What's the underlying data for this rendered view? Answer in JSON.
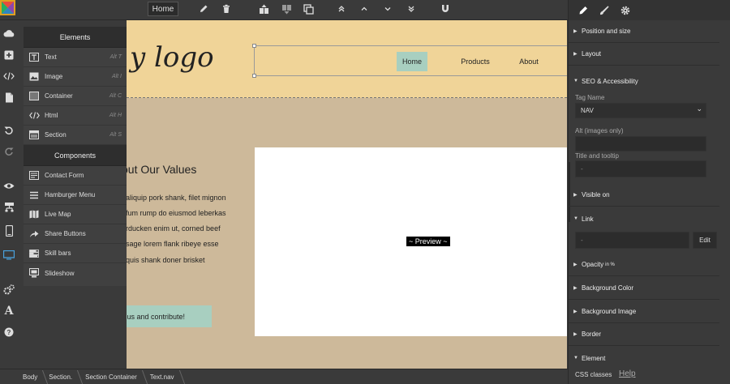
{
  "toolbar": {
    "home_tab": "Home",
    "icons": [
      "pencil-icon",
      "trash-icon",
      "clone-up-icon",
      "clone-down-icon",
      "copy-icon",
      "chevron-double-up-icon",
      "chevron-up-icon",
      "chevron-down-icon",
      "chevron-double-down-icon",
      "magnet-icon"
    ]
  },
  "left_toolbar": {
    "icons": [
      "cloud-icon",
      "plus-box-icon",
      "code-icon",
      "file-icon",
      "undo-icon",
      "redo-icon",
      "eye-icon",
      "tree-icon",
      "mobile-icon",
      "desktop-icon",
      "settings-icon",
      "font-icon",
      "help-icon"
    ]
  },
  "blocks": {
    "elements_header": "Elements",
    "elements": [
      {
        "label": "Text",
        "shortcut": "Alt T",
        "icon": "text-block-icon"
      },
      {
        "label": "Image",
        "shortcut": "Alt I",
        "icon": "image-block-icon"
      },
      {
        "label": "Container",
        "shortcut": "Alt C",
        "icon": "container-block-icon"
      },
      {
        "label": "Html",
        "shortcut": "Alt H",
        "icon": "html-block-icon"
      },
      {
        "label": "Section",
        "shortcut": "Alt S",
        "icon": "section-block-icon"
      }
    ],
    "components_header": "Components",
    "components": [
      {
        "label": "Contact Form",
        "icon": "contact-form-icon"
      },
      {
        "label": "Hamburger Menu",
        "icon": "hamburger-icon"
      },
      {
        "label": "Live Map",
        "icon": "map-icon"
      },
      {
        "label": "Share Buttons",
        "icon": "share-icon"
      },
      {
        "label": "Skill bars",
        "icon": "skill-bars-icon"
      },
      {
        "label": "Slideshow",
        "icon": "slideshow-icon"
      }
    ]
  },
  "canvas": {
    "logo_text": "y logo",
    "nav": [
      "Home",
      "Products",
      "About"
    ],
    "values_title": "out Our Values",
    "values_lines": [
      "aliquip pork shank, filet mignon",
      "fum rump do eiusmod leberkas",
      "rducken enim ut, corned beef",
      "sage lorem flank ribeye esse",
      "quis shank doner brisket"
    ],
    "contribute": "n us and contribute!",
    "preview_label": "~ Preview ~"
  },
  "breadcrumb": [
    "Body",
    "Section.",
    "Section Container",
    "Text.nav"
  ],
  "right_panel": {
    "tabs": [
      "pencil-icon",
      "brush-icon",
      "gear-icon"
    ],
    "sections": {
      "position_size": "Position and size",
      "layout": "Layout",
      "seo": "SEO & Accessibility",
      "visible_on": "Visible on",
      "link": "Link",
      "opacity": "Opacity",
      "opacity_unit": "in %",
      "bg_color": "Background Color",
      "bg_image": "Background Image",
      "border": "Border",
      "element": "Element"
    },
    "tag_name_label": "Tag Name",
    "tag_name_value": "NAV",
    "alt_label": "Alt (images only)",
    "title_label": "Title and tooltip",
    "title_value": "-",
    "link_value": "-",
    "edit_button": "Edit",
    "css_classes": "CSS classes",
    "help": "Help"
  }
}
